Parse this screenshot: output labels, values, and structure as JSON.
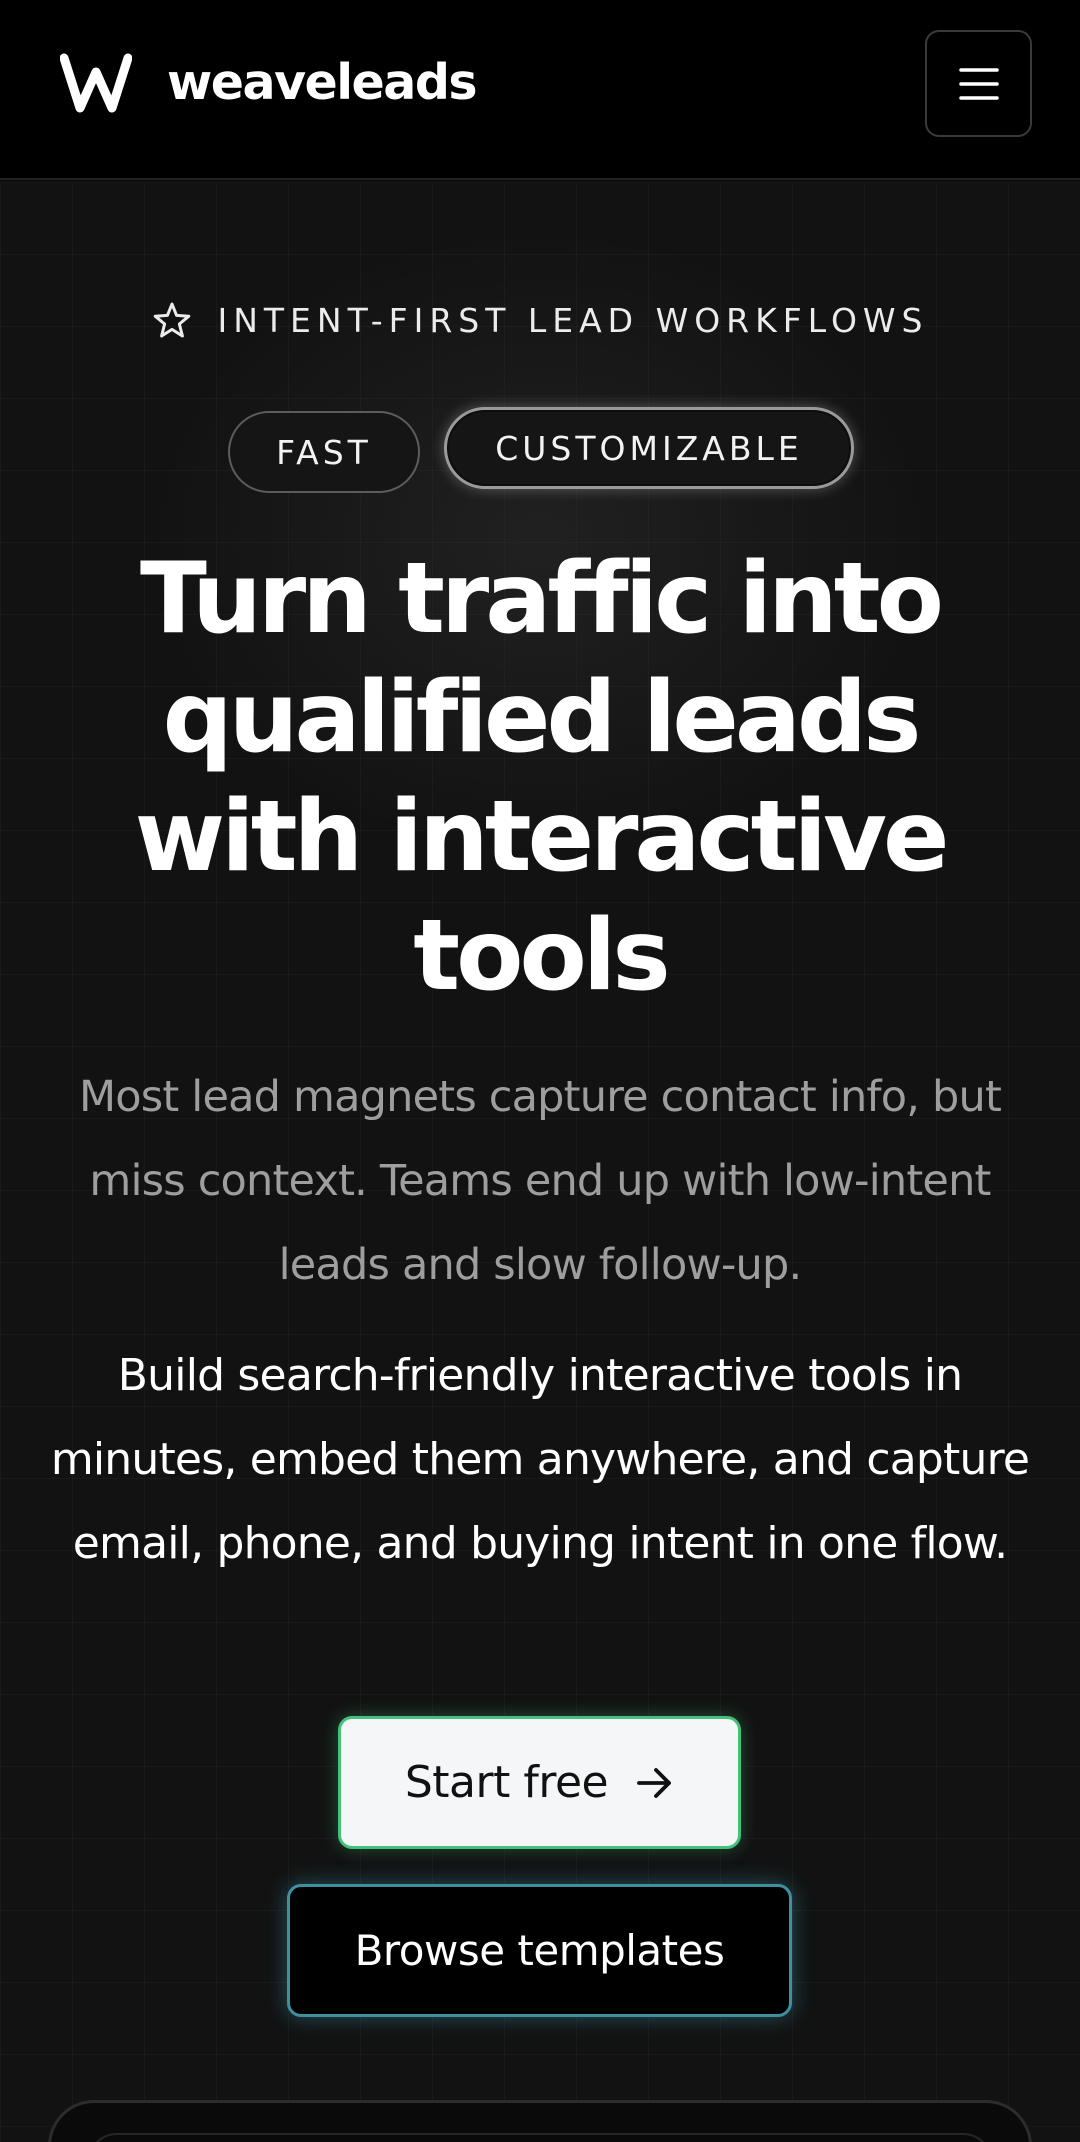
{
  "header": {
    "brand_name": "weaveleads",
    "logo_icon": "weave-w-logo",
    "menu_icon": "hamburger-menu-icon"
  },
  "hero": {
    "eyebrow": "INTENT-FIRST LEAD WORKFLOWS",
    "eyebrow_icon": "star-outline-icon",
    "pills": [
      "FAST",
      "CUSTOMIZABLE"
    ],
    "headline": "Turn traffic into qualified leads with interactive tools",
    "subtext": "Most lead magnets capture contact info, but miss context. Teams end up with low-intent leads and slow follow-up.",
    "body": "Build search-friendly interactive tools in minutes, embed them anywhere, and capture email, phone, and buying intent in one flow.",
    "primary_button": "Start free",
    "primary_button_icon": "arrow-right-icon",
    "secondary_button": "Browse templates"
  },
  "colors": {
    "background": "#121212",
    "header_background": "#000000",
    "primary_button_bg": "#f4f6f8",
    "primary_button_border": "#44c07a",
    "secondary_button_border": "#3f8f9f",
    "muted_text": "#9e9e9e"
  }
}
